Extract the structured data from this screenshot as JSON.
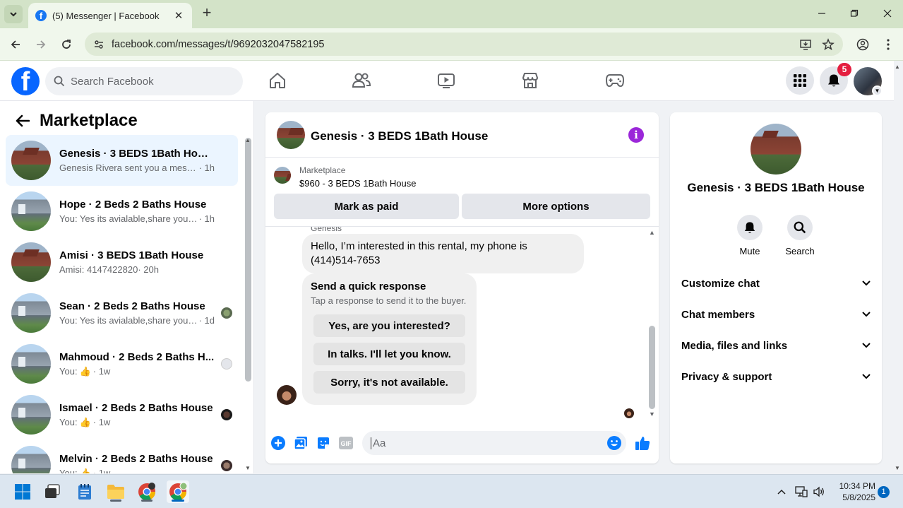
{
  "browser": {
    "tab_title": "(5) Messenger | Facebook",
    "url": "facebook.com/messages/t/9692032047582195"
  },
  "fb_header": {
    "search_placeholder": "Search Facebook",
    "notification_count": "5"
  },
  "sidebar": {
    "title": "Marketplace",
    "chats": [
      {
        "name": "Genesis · 3 BEDS 1Bath House",
        "preview": "Genesis Rivera sent you a message ...",
        "time": "· 1h",
        "thumb": "red"
      },
      {
        "name": "Hope · 2 Beds 2 Baths House",
        "preview": "You: Yes its avialable,share your con...",
        "time": "· 1h",
        "thumb": "grey"
      },
      {
        "name": "Amisi · 3 BEDS 1Bath House",
        "preview": "Amisi: 4147422820",
        "time": "· 20h",
        "thumb": "red"
      },
      {
        "name": "Sean · 2 Beds 2 Baths House",
        "preview": "You: Yes its avialable,share your ...",
        "time": "· 1d",
        "thumb": "grey"
      },
      {
        "name": "Mahmoud · 2 Beds 2 Baths H...",
        "preview": "You: ",
        "time": "· 1w",
        "thumb": "grey",
        "like": true
      },
      {
        "name": "Ismael · 2 Beds 2 Baths House",
        "preview": "You: ",
        "time": "· 1w",
        "thumb": "grey",
        "like": true
      },
      {
        "name": "Melvin · 2 Beds 2 Baths House",
        "preview": "You: ",
        "time": "· 1w",
        "thumb": "grey",
        "like": true
      }
    ]
  },
  "chat": {
    "title": "Genesis · 3 BEDS 1Bath House",
    "marketplace_label": "Marketplace",
    "listing": "$960 - 3 BEDS 1Bath House",
    "mark_paid_label": "Mark as paid",
    "more_options_label": "More options",
    "sender_name": "Genesis",
    "message": "Hello, I’m interested in this rental, my phone is (414)514-7653",
    "quick_response": {
      "title": "Send a quick response",
      "subtitle": "Tap a response to send it to the buyer.",
      "options": [
        "Yes, are you interested?",
        "In talks. I'll let you know.",
        "Sorry, it's not available."
      ]
    },
    "composer_placeholder": "Aa"
  },
  "info_panel": {
    "name": "Genesis · 3 BEDS 1Bath House",
    "mute_label": "Mute",
    "search_label": "Search",
    "sections": [
      "Customize chat",
      "Chat members",
      "Media, files and links",
      "Privacy & support"
    ]
  },
  "taskbar": {
    "time": "10:34 PM",
    "date": "5/8/2025",
    "notification_count": "1"
  },
  "colors": {
    "fb_blue": "#0866ff",
    "messenger_blue": "#0a7cff",
    "info_purple": "#9b27d9",
    "badge_red": "#e41e3f"
  }
}
